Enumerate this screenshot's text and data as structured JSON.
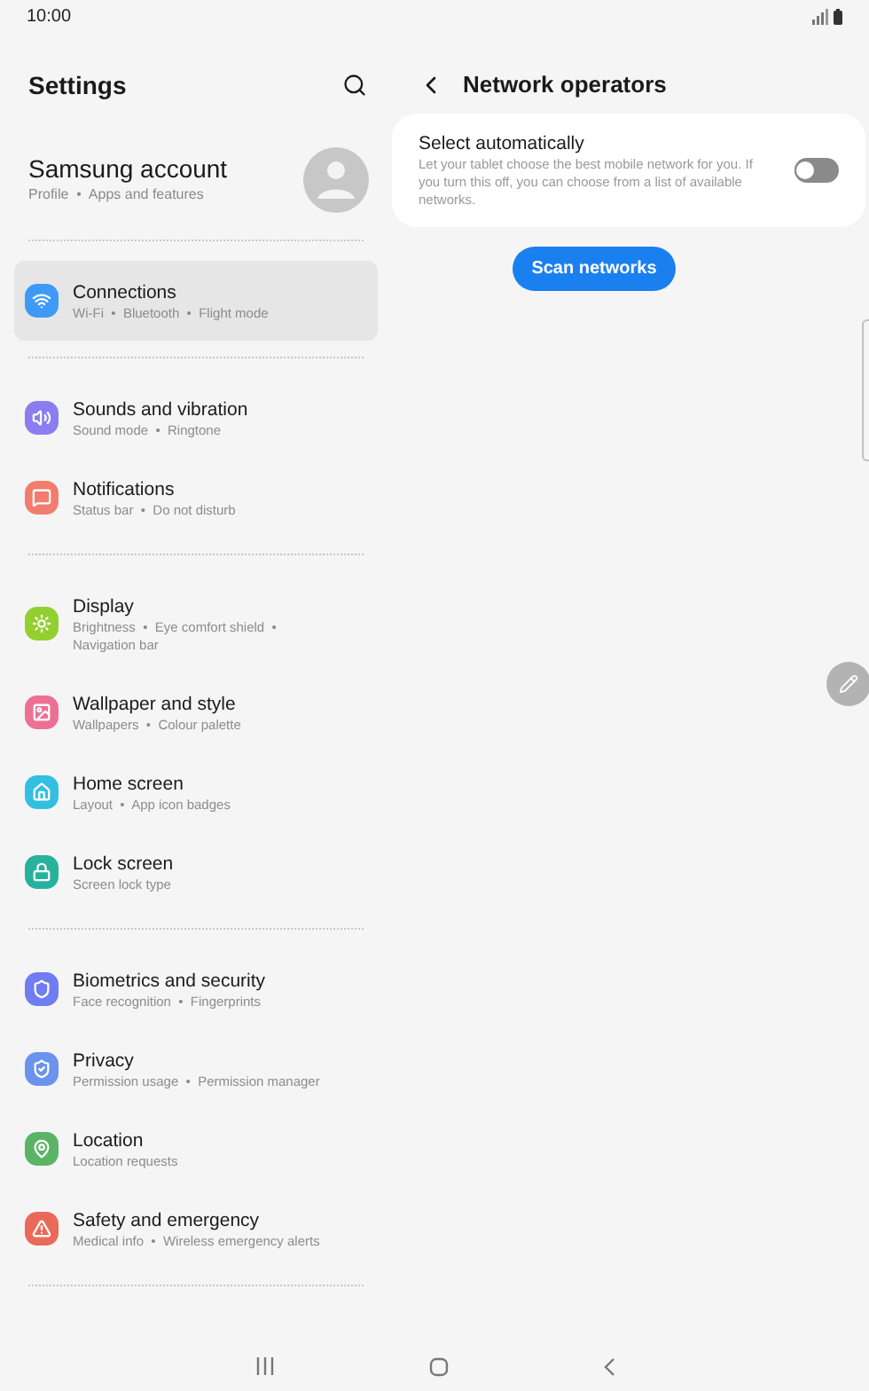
{
  "status_bar": {
    "time": "10:00"
  },
  "settings": {
    "title": "Settings",
    "account": {
      "title": "Samsung account",
      "subtitle": "Profile  •  Apps and features"
    },
    "groups": [
      {
        "items": [
          {
            "title": "Connections",
            "subtitle": "Wi-Fi  •  Bluetooth  •  Flight mode",
            "color": "#3e9af5",
            "selected": true
          }
        ]
      },
      {
        "items": [
          {
            "title": "Sounds and vibration",
            "subtitle": "Sound mode  •  Ringtone",
            "color": "#8b7cf0",
            "selected": false
          },
          {
            "title": "Notifications",
            "subtitle": "Status bar  •  Do not disturb",
            "color": "#f27d6e",
            "selected": false
          }
        ]
      },
      {
        "items": [
          {
            "title": "Display",
            "subtitle": "Brightness  •  Eye comfort shield  •  Navigation bar",
            "color": "#94cf30",
            "selected": false
          },
          {
            "title": "Wallpaper and style",
            "subtitle": "Wallpapers  •  Colour palette",
            "color": "#ee6f94",
            "selected": false
          },
          {
            "title": "Home screen",
            "subtitle": "Layout  •  App icon badges",
            "color": "#32bfe0",
            "selected": false
          },
          {
            "title": "Lock screen",
            "subtitle": "Screen lock type",
            "color": "#27b29c",
            "selected": false
          }
        ]
      },
      {
        "items": [
          {
            "title": "Biometrics and security",
            "subtitle": "Face recognition  •  Fingerprints",
            "color": "#6f7cf2",
            "selected": false
          },
          {
            "title": "Privacy",
            "subtitle": "Permission usage  •  Permission manager",
            "color": "#6b93ee",
            "selected": false
          },
          {
            "title": "Location",
            "subtitle": "Location requests",
            "color": "#5bb465",
            "selected": false
          },
          {
            "title": "Safety and emergency",
            "subtitle": "Medical info  •  Wireless emergency alerts",
            "color": "#ea6a5a",
            "selected": false
          }
        ]
      }
    ]
  },
  "detail": {
    "title": "Network operators",
    "auto_select": {
      "title": "Select automatically",
      "description": "Let your tablet choose the best mobile network for you. If you turn this off, you can choose from a list of available networks.",
      "on": false
    },
    "scan_button": "Scan networks"
  }
}
